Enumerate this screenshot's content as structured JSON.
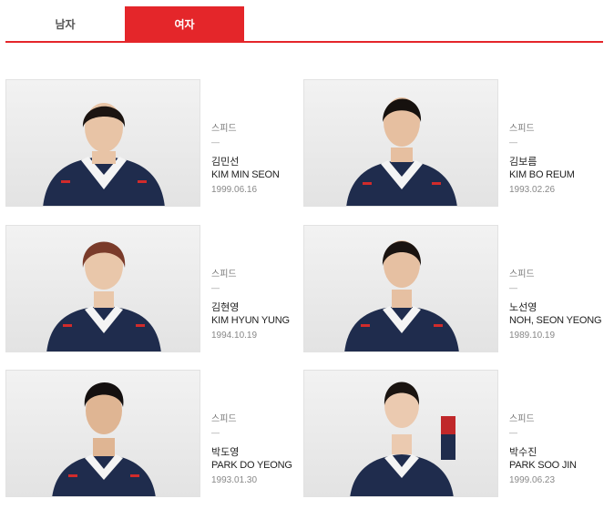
{
  "tabs": [
    {
      "label": "남자",
      "active": false
    },
    {
      "label": "여자",
      "active": true
    }
  ],
  "accent_color": "#e4262a",
  "athletes": [
    {
      "event": "스피드",
      "divider": "—",
      "name_kr": "김민선",
      "name_en": "KIM MIN SEON",
      "dob": "1999.06.16"
    },
    {
      "event": "스피드",
      "divider": "—",
      "name_kr": "김보름",
      "name_en": "KIM BO REUM",
      "dob": "1993.02.26"
    },
    {
      "event": "스피드",
      "divider": "—",
      "name_kr": "김현영",
      "name_en": "KIM HYUN YUNG",
      "dob": "1994.10.19"
    },
    {
      "event": "스피드",
      "divider": "—",
      "name_kr": "노선영",
      "name_en": "NOH, SEON YEONG",
      "dob": "1989.10.19"
    },
    {
      "event": "스피드",
      "divider": "—",
      "name_kr": "박도영",
      "name_en": "PARK DO YEONG",
      "dob": "1993.01.30"
    },
    {
      "event": "스피드",
      "divider": "—",
      "name_kr": "박수진",
      "name_en": "PARK SOO JIN",
      "dob": "1999.06.23"
    }
  ]
}
